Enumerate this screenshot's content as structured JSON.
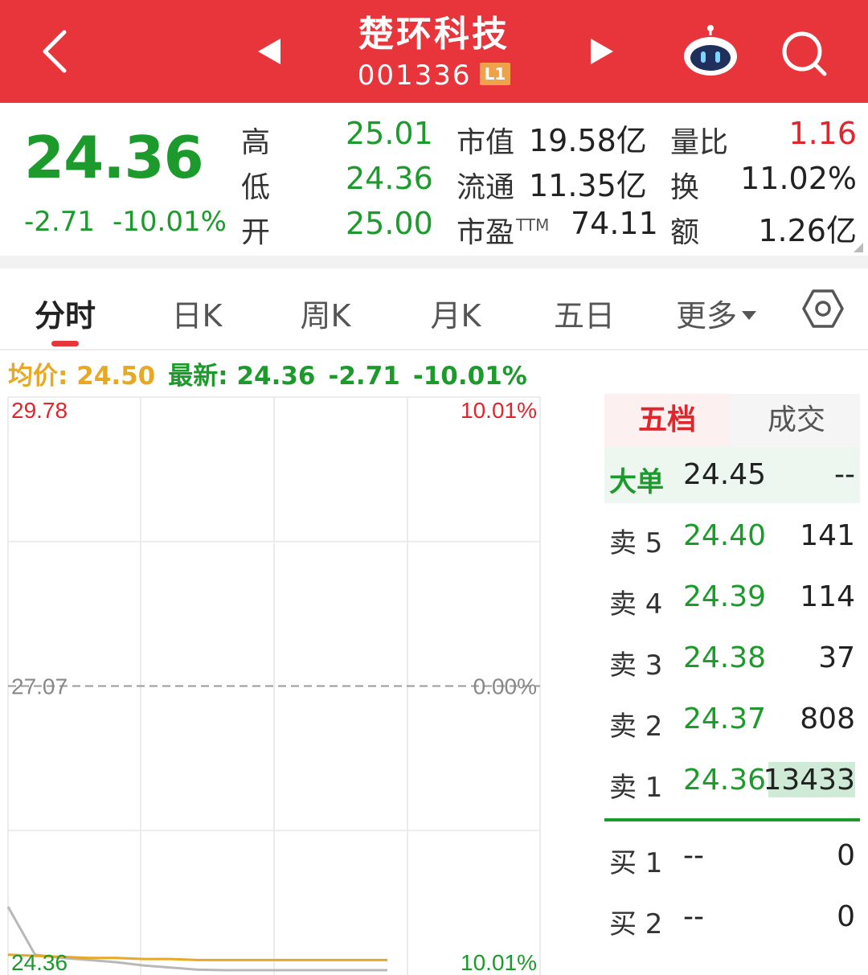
{
  "header": {
    "title": "楚环科技",
    "code": "001336",
    "level_badge": "L1"
  },
  "quote": {
    "price": "24.36",
    "change": "-2.71",
    "change_pct": "-10.01%",
    "high_label": "高",
    "high": "25.01",
    "low_label": "低",
    "low": "24.36",
    "open_label": "开",
    "open": "25.00",
    "mktcap_label": "市值",
    "mktcap": "19.58亿",
    "float_label": "流通",
    "float": "11.35亿",
    "pe_label": "市盈",
    "pe_sup": "TTM",
    "pe": "74.11",
    "vol_ratio_label": "量比",
    "vol_ratio": "1.16",
    "turnover_label": "换",
    "turnover": "11.02%",
    "amount_label": "额",
    "amount": "1.26亿"
  },
  "tabs": {
    "intraday": "分时",
    "daily": "日K",
    "weekly": "周K",
    "monthly": "月K",
    "five_day": "五日",
    "more": "更多"
  },
  "info": {
    "avg": "均价: 24.50",
    "latest_label": "最新: 24.36",
    "latest_chg": "-2.71",
    "latest_pct": "-10.01%"
  },
  "chart_data": {
    "type": "line",
    "y_top_label": "29.78",
    "y_mid_label": "27.07",
    "y_bottom_label": "24.36",
    "pct_top_label": "10.01%",
    "pct_mid_label": "0.00%",
    "pct_bottom_label": "10.01%",
    "ylim": [
      24.36,
      29.78
    ],
    "prev_close": 27.07,
    "series": [
      {
        "values": [
          25.0,
          24.55,
          24.52,
          24.5,
          24.48,
          24.45,
          24.43,
          24.41,
          24.4,
          24.38,
          24.37,
          24.36,
          24.36,
          24.36,
          24.36
        ]
      },
      {
        "values": [
          24.55,
          24.54,
          24.53,
          24.52,
          24.52,
          24.51,
          24.51,
          24.5,
          24.5,
          24.5,
          24.5,
          24.5,
          24.5,
          24.5,
          24.5
        ]
      }
    ],
    "colors": {
      "price": "#b8b8b8",
      "avg": "#e7a826",
      "grid": "#ececec",
      "mid": "#9a9a9a"
    }
  },
  "book": {
    "tab_active": "五档",
    "tab_other": "成交",
    "big_label": "大单",
    "big_price": "24.45",
    "big_vol": "--",
    "asks": [
      {
        "label": "卖 5",
        "price": "24.40",
        "vol": "141"
      },
      {
        "label": "卖 4",
        "price": "24.39",
        "vol": "114"
      },
      {
        "label": "卖 3",
        "price": "24.38",
        "vol": "37"
      },
      {
        "label": "卖 2",
        "price": "24.37",
        "vol": "808"
      },
      {
        "label": "卖 1",
        "price": "24.36",
        "vol": "13433"
      }
    ],
    "bids": [
      {
        "label": "买 1",
        "price": "--",
        "vol": "0"
      },
      {
        "label": "买 2",
        "price": "--",
        "vol": "0"
      }
    ]
  },
  "colors": {
    "brand_red": "#e8353b",
    "down_green": "#1c9a2c",
    "up_red": "#e0262d",
    "avg_yellow": "#e7a826"
  }
}
